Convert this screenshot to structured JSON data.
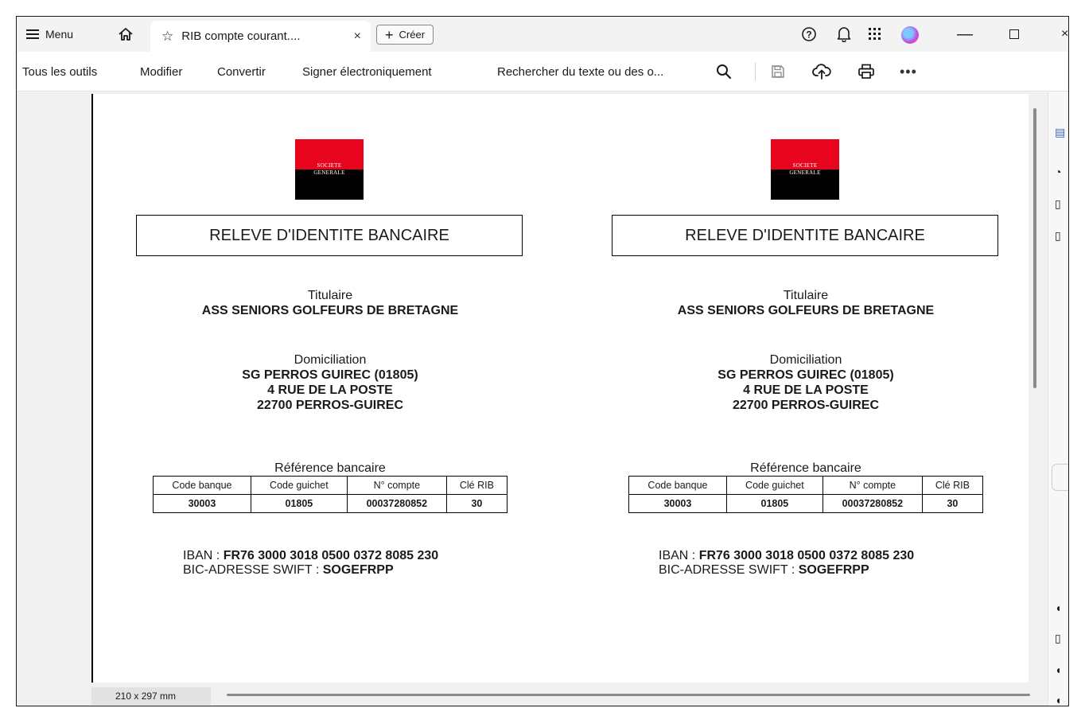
{
  "titlebar": {
    "menu_label": "Menu",
    "tab_title": "RIB compte courant....",
    "tab_close": "×",
    "create_label": "Créer",
    "help": "?",
    "minimize": "—",
    "close": "×"
  },
  "toolbar": {
    "all_tools": "Tous les outils",
    "edit": "Modifier",
    "convert": "Convertir",
    "sign": "Signer électroniquement",
    "search": "Rechercher du texte ou des o...",
    "more": "•••"
  },
  "document": {
    "logo_top": "SOCIETE",
    "logo_bottom": "GENERALE",
    "title": "RELEVE D'IDENTITE BANCAIRE",
    "holder_label": "Titulaire",
    "holder_name": "ASS SENIORS GOLFEURS DE BRETAGNE",
    "domiciliation_label": "Domiciliation",
    "domiciliation_lines": [
      "SG PERROS GUIREC (01805)",
      "4 RUE DE LA POSTE",
      "22700 PERROS-GUIREC"
    ],
    "ref_label": "Référence bancaire",
    "table_headers": [
      "Code banque",
      "Code guichet",
      "N° compte",
      "Clé RIB"
    ],
    "table_values": [
      "30003",
      "01805",
      "00037280852",
      "30"
    ],
    "iban_label": "IBAN : ",
    "iban_value": "FR76 3000 3018 0500 0372 8085 230",
    "bic_label": "BIC-ADRESSE SWIFT : ",
    "bic_value": "SOGEFRPP"
  },
  "status": {
    "page_size": "210 x 297 mm"
  },
  "icons": [
    "hamburger-icon",
    "home-icon",
    "star-icon",
    "plus-icon",
    "help-icon",
    "bell-icon",
    "apps-grid-icon",
    "search-icon",
    "save-icon",
    "upload-icon",
    "print-icon",
    "more-icon"
  ],
  "colors": {
    "sg_red": "#e9041e",
    "sg_black": "#000000"
  }
}
